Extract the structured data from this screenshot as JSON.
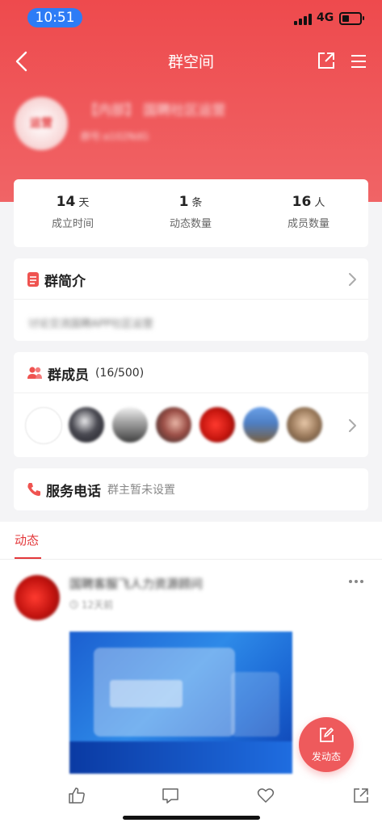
{
  "status_bar": {
    "time": "10:51",
    "network": "4G"
  },
  "nav": {
    "title": "群空间"
  },
  "group": {
    "name": "【内部】 国聘社区运营",
    "id_text": "群号:a102NdG",
    "avatar_text": "运营"
  },
  "stats": [
    {
      "num": "14",
      "unit": "天",
      "label": "成立时间"
    },
    {
      "num": "1",
      "unit": "条",
      "label": "动态数量"
    },
    {
      "num": "16",
      "unit": "人",
      "label": "成员数量"
    }
  ],
  "intro": {
    "title": "群简介",
    "text": "讨论交流国聘APP社区运营"
  },
  "members": {
    "title": "群成员",
    "count": "(16/500)"
  },
  "phone": {
    "title": "服务电话",
    "status": "群主暂未设置"
  },
  "feed": {
    "tab": "动态",
    "post": {
      "author": "国聘客服飞人力资源顾问",
      "time": "12天前"
    }
  },
  "fab": {
    "label": "发动态"
  },
  "colors": {
    "brand": "#ee4a4d",
    "accent": "#e3383b",
    "fab": "#ee5a5c"
  }
}
